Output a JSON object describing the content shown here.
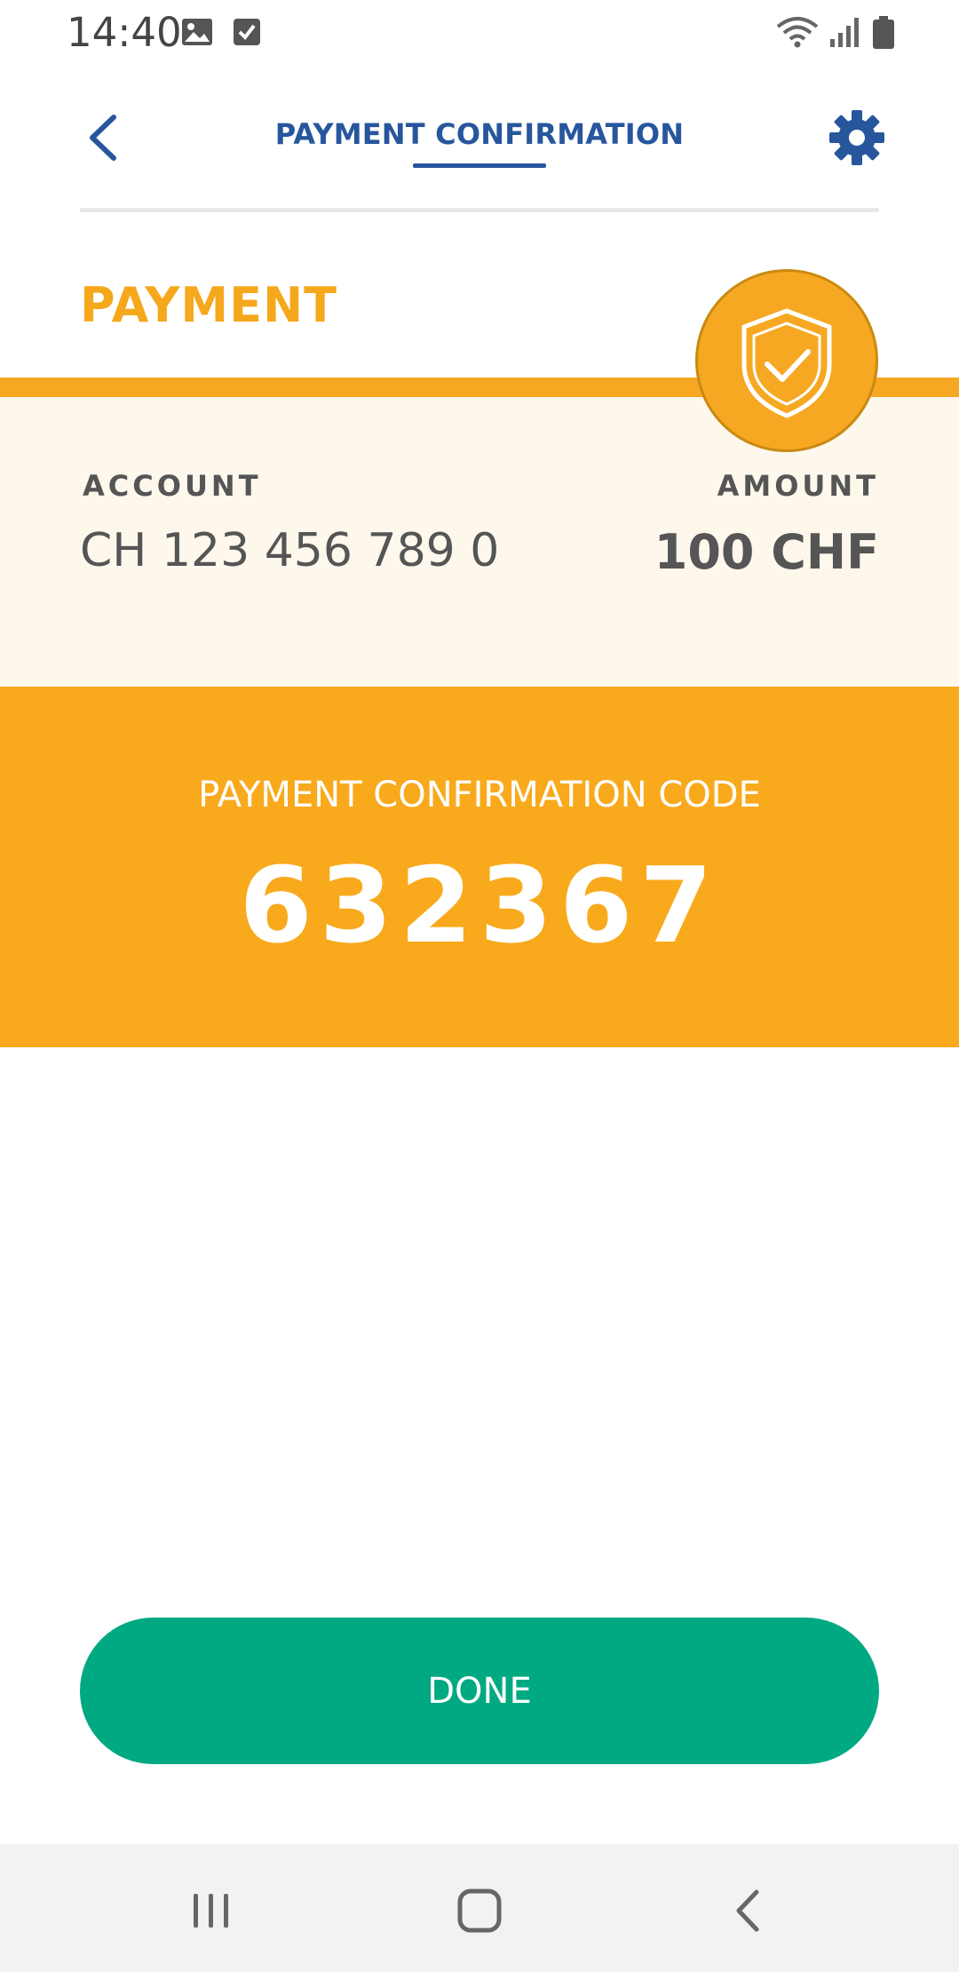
{
  "status_bar": {
    "time": "14:40",
    "icons": [
      "image-icon",
      "checkbox-icon",
      "wifi-icon",
      "signal-icon",
      "battery-icon"
    ]
  },
  "header": {
    "title": "PAYMENT CONFIRMATION",
    "back_icon": "chevron-left-icon",
    "settings_icon": "gear-icon"
  },
  "payment": {
    "section_title": "PAYMENT",
    "badge_icon": "shield-check-icon",
    "account_label": "ACCOUNT",
    "account_value": "CH 123 456 789 0",
    "amount_label": "AMOUNT",
    "amount_value": "100 CHF"
  },
  "confirmation": {
    "code_label": "PAYMENT CONFIRMATION CODE",
    "code_value": "632367"
  },
  "actions": {
    "done_label": "DONE"
  },
  "nav_bar": {
    "recents_icon": "recents-icon",
    "home_icon": "home-icon",
    "back_icon": "back-icon"
  },
  "colors": {
    "brand_blue": "#27569d",
    "accent_orange": "#f9a91c",
    "panel_cream": "#fdf7ec",
    "done_green": "#00a981"
  }
}
